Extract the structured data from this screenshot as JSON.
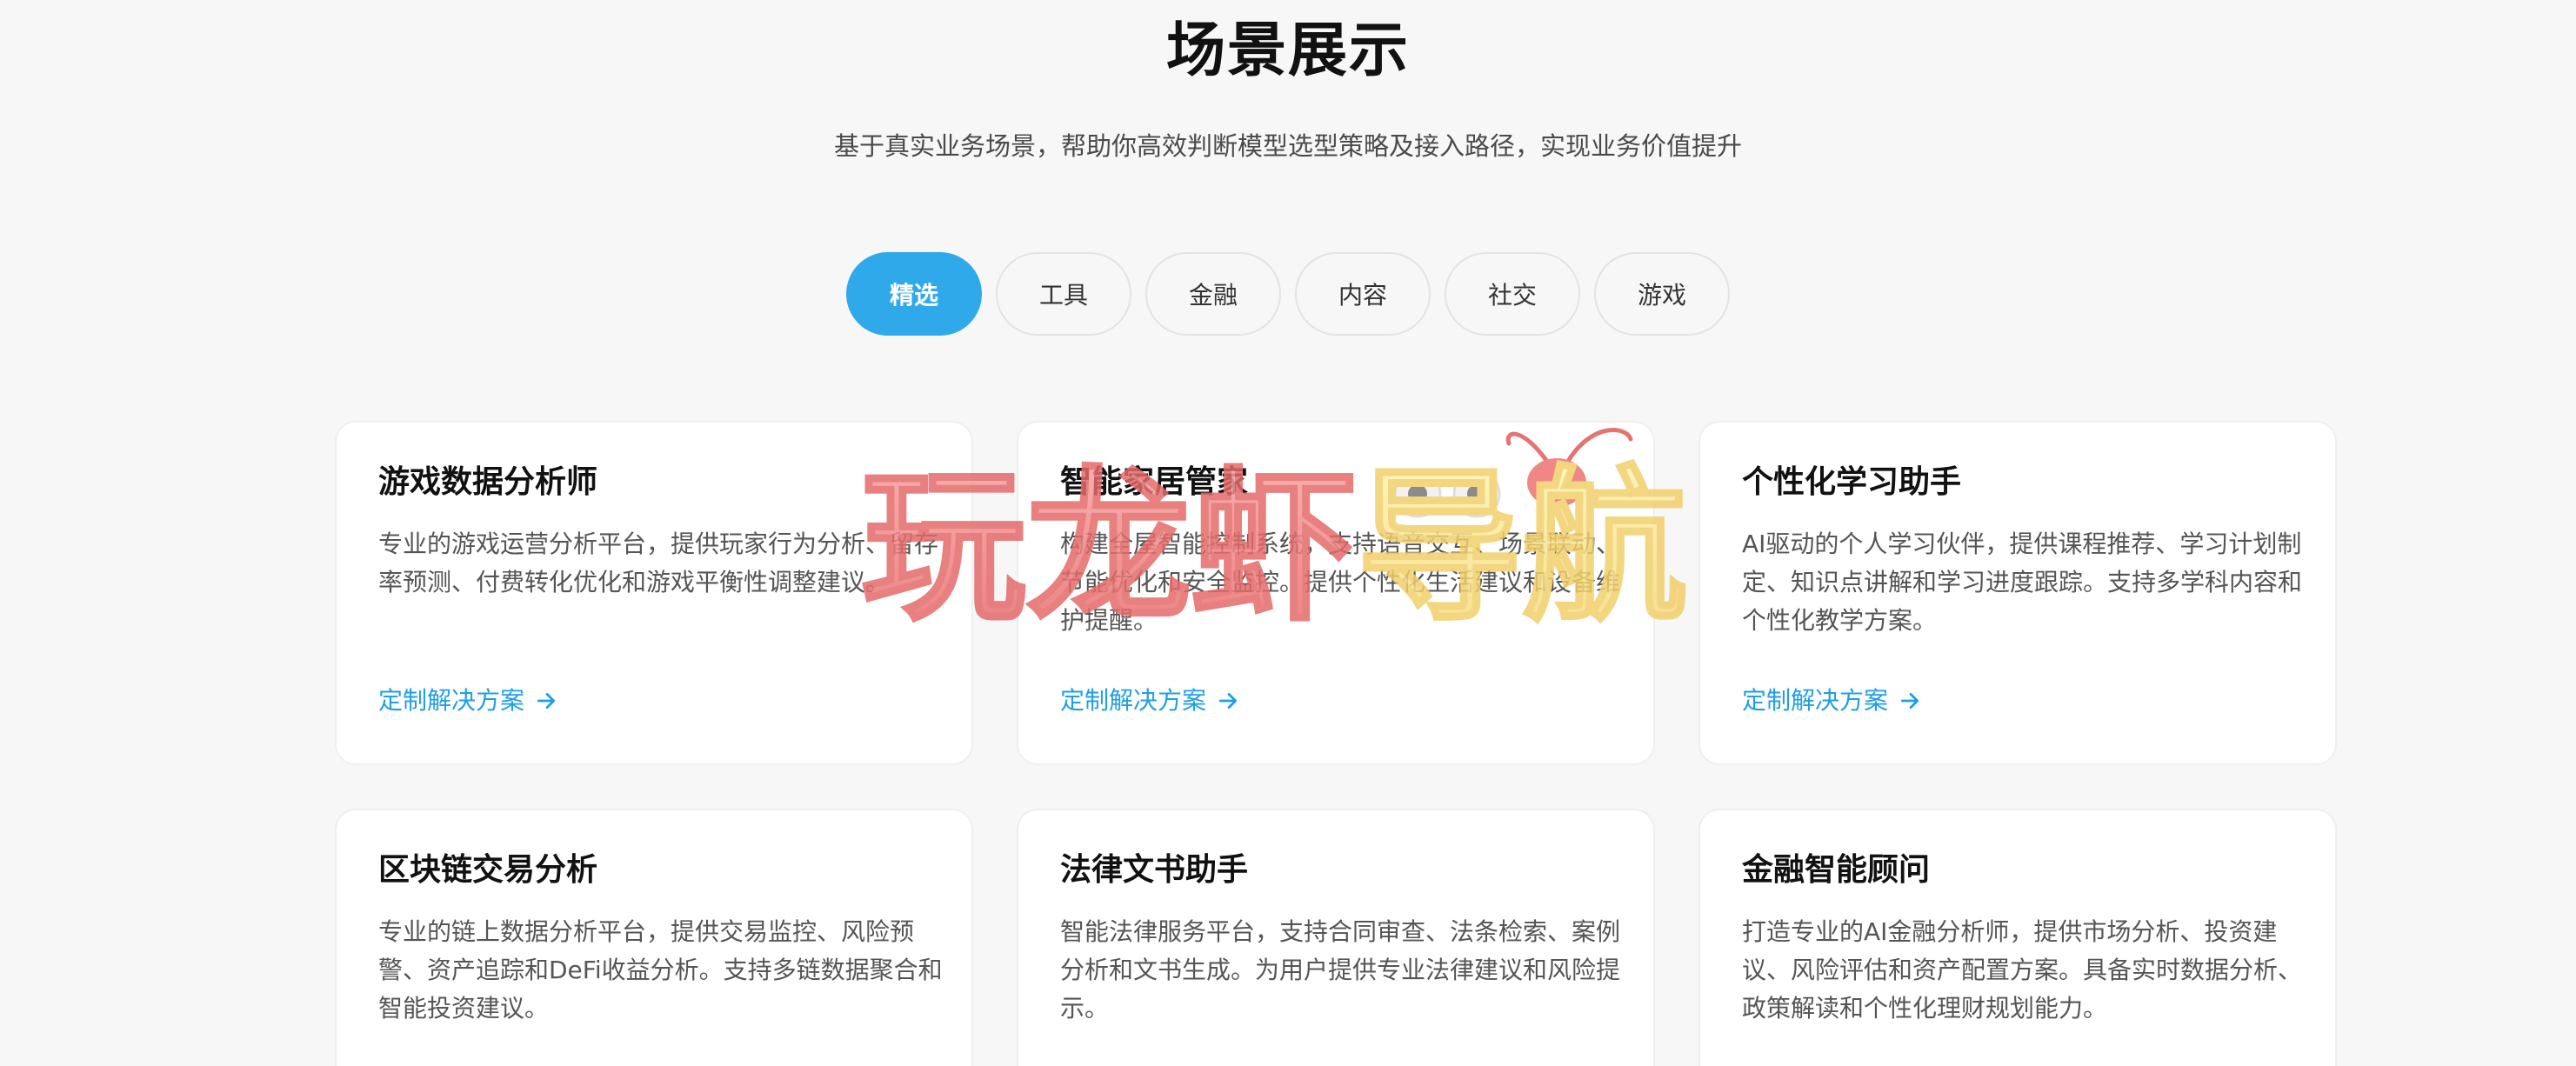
{
  "header": {
    "title": "场景展示",
    "subtitle": "基于真实业务场景，帮助你高效判断模型选型策略及接入路径，实现业务价值提升"
  },
  "tabs": [
    {
      "label": "精选",
      "active": true
    },
    {
      "label": "工具",
      "active": false
    },
    {
      "label": "金融",
      "active": false
    },
    {
      "label": "内容",
      "active": false
    },
    {
      "label": "社交",
      "active": false
    },
    {
      "label": "游戏",
      "active": false
    }
  ],
  "cards": [
    {
      "title": "游戏数据分析师",
      "description": "专业的游戏运营分析平台，提供玩家行为分析、留存率预测、付费转化优化和游戏平衡性调整建议。",
      "link": "定制解决方案"
    },
    {
      "title": "智能家居管家",
      "description": "构建全屋智能控制系统，支持语音交互、场景联动、节能优化和安全监控。提供个性化生活建议和设备维护提醒。",
      "link": "定制解决方案"
    },
    {
      "title": "个性化学习助手",
      "description": "AI驱动的个人学习伙伴，提供课程推荐、学习计划制定、知识点讲解和学习进度跟踪。支持多学科内容和个性化教学方案。",
      "link": "定制解决方案"
    },
    {
      "title": "区块链交易分析",
      "description": "专业的链上数据分析平台，提供交易监控、风险预警、资产追踪和DeFi收益分析。支持多链数据聚合和智能投资建议。",
      "link": ""
    },
    {
      "title": "法律文书助手",
      "description": "智能法律服务平台，支持合同审查、法条检索、案例分析和文书生成。为用户提供专业法律建议和风险提示。",
      "link": ""
    },
    {
      "title": "金融智能顾问",
      "description": "打造专业的AI金融分析师，提供市场分析、投资建议、风险评估和资产配置方案。具备实时数据分析、政策解读和个性化理财规划能力。",
      "link": ""
    }
  ],
  "watermark": {
    "text": "玩龙虾导航"
  },
  "colors": {
    "accent": "#2fa9ea",
    "link": "#1f9fe6",
    "background": "#f7f7f8"
  }
}
